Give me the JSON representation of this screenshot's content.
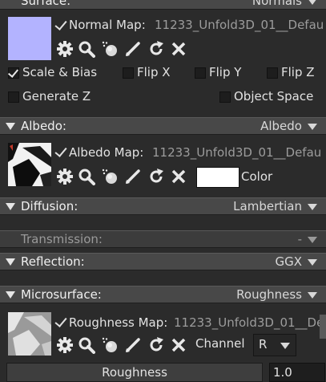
{
  "surface": {
    "header_label": "Surface:",
    "header_value": "Normals",
    "swatch_color": "#b3b3ff",
    "map_label": "Normal Map:",
    "map_file": "11233_Unfold3D_01__Defau",
    "scale_bias": "Scale & Bias",
    "flip_x": "Flip X",
    "flip_y": "Flip Y",
    "flip_z": "Flip Z",
    "generate_z": "Generate Z",
    "object_space": "Object Space"
  },
  "albedo": {
    "header_label": "Albedo:",
    "header_value": "Albedo",
    "map_label": "Albedo Map:",
    "map_file": "11233_Unfold3D_01__Defau",
    "color_label": "Color",
    "color_value": "#ffffff"
  },
  "diffusion": {
    "header_label": "Diffusion:",
    "header_value": "Lambertian"
  },
  "transmission": {
    "header_label": "Transmission:",
    "header_value": "-"
  },
  "reflection": {
    "header_label": "Reflection:",
    "header_value": "GGX"
  },
  "microsurface": {
    "header_label": "Microsurface:",
    "header_value": "Roughness",
    "map_label": "Roughness Map:",
    "map_file": "11233_Unfold3D_01__Def",
    "channel_label": "Channel",
    "channel_value": "R",
    "slider_label": "Roughness",
    "slider_value": "1.0"
  },
  "icons": [
    "gear-icon",
    "magnifier-icon",
    "sphere-icon",
    "pencil-icon",
    "reload-icon",
    "close-icon"
  ]
}
